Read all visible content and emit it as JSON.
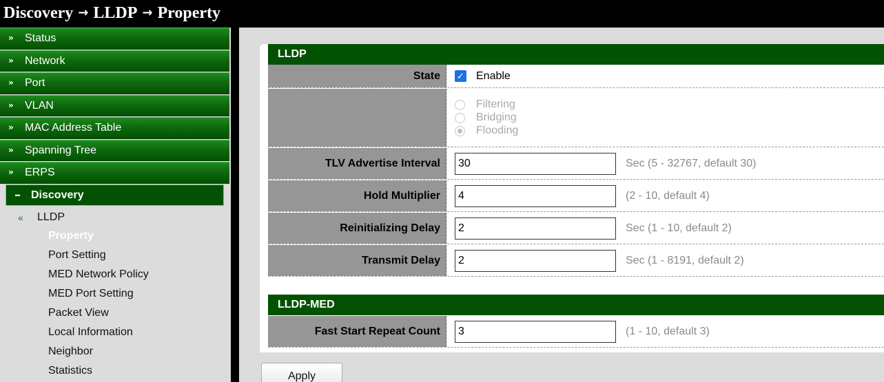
{
  "breadcrumb": [
    "Discovery",
    "LLDP",
    "Property"
  ],
  "sidebar": {
    "items": [
      {
        "label": "Status"
      },
      {
        "label": "Network"
      },
      {
        "label": "Port"
      },
      {
        "label": "VLAN"
      },
      {
        "label": "MAC Address Table"
      },
      {
        "label": "Spanning Tree"
      },
      {
        "label": "ERPS"
      }
    ],
    "active": {
      "label": "Discovery"
    },
    "group_label": "LLDP",
    "sub_items": [
      "Property",
      "Port Setting",
      "MED Network Policy",
      "MED Port Setting",
      "Packet View",
      "Local Information",
      "Neighbor",
      "Statistics"
    ]
  },
  "lldp": {
    "title": "LLDP",
    "state_label": "State",
    "state_value": "Enable",
    "radios": [
      "Filtering",
      "Bridging",
      "Flooding"
    ],
    "fields": [
      {
        "label": "TLV Advertise Interval",
        "value": "30",
        "hint": "Sec (5 - 32767, default 30)"
      },
      {
        "label": "Hold Multiplier",
        "value": "4",
        "hint": "(2 - 10, default 4)"
      },
      {
        "label": "Reinitializing Delay",
        "value": "2",
        "hint": "Sec (1 - 10, default 2)"
      },
      {
        "label": "Transmit Delay",
        "value": "2",
        "hint": "Sec (1 - 8191, default 2)"
      }
    ]
  },
  "lldp_med": {
    "title": "LLDP-MED",
    "label": "Fast Start Repeat Count",
    "value": "3",
    "hint": "(1 - 10, default 3)"
  },
  "apply_label": "Apply"
}
